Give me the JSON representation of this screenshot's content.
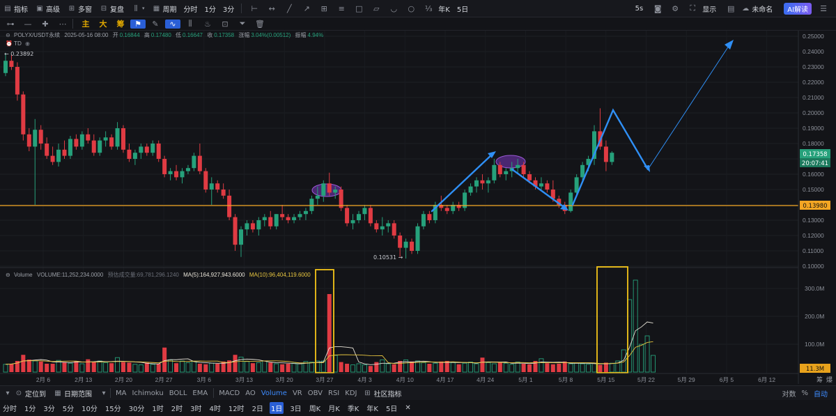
{
  "toolbar": {
    "items": [
      {
        "icon": "indicator-icon",
        "label": "指标"
      },
      {
        "icon": "advanced-icon",
        "label": "高级"
      },
      {
        "icon": "multi-window-icon",
        "label": "多窗"
      },
      {
        "icon": "replay-icon",
        "label": "复盘"
      }
    ],
    "period_label": "周期",
    "quick_periods": [
      "分时",
      "1分",
      "3分"
    ],
    "draw_tools": [
      "horizontal-ray-icon",
      "horizontal-line-icon",
      "trend-line-icon",
      "arrow-line-icon",
      "crosshair-tool-icon",
      "parallel-channel-icon",
      "rectangle-icon",
      "parallelogram-icon",
      "curve-icon",
      "circle-icon",
      "fibonacci-icon"
    ],
    "period_tabs": [
      "年K",
      "5日"
    ],
    "right": {
      "refresh": "5s",
      "display": "显示",
      "unnamed": "未命名",
      "ai": "AI解读"
    }
  },
  "drawbar": {
    "tools": [
      "line-tool-icon",
      "ray-tool-icon",
      "cross-tool-icon",
      "more-icon"
    ],
    "cn_buttons": [
      "主",
      "大",
      "筹"
    ],
    "tail_tools": [
      "marker-icon",
      "ruler-icon",
      "pattern-icon",
      "candle-icon",
      "fire-icon",
      "group-icon",
      "filter-icon",
      "trash-icon"
    ]
  },
  "header": {
    "symbol": "POLYX/USDT永续",
    "datetime": "2025-05-16 08:00",
    "open_label": "开",
    "open": "0.16844",
    "high_label": "高",
    "high": "0.17480",
    "low_label": "低",
    "low": "0.16647",
    "close_label": "收",
    "close": "0.17358",
    "change_label": "涨幅",
    "change": "3.04%(0.00512)",
    "amp_label": "振幅",
    "amp": "4.94%",
    "td": "TD"
  },
  "volume_header": {
    "name": "Volume",
    "volume": "VOLUME:11,252,234.0000",
    "est": "预估成交量:69,781,296.1240",
    "ma5": "MA(5):164,927,943.6000",
    "ma10": "MA(10):96,404,119.6000"
  },
  "chart_data": {
    "type": "candlestick",
    "price_axis": {
      "min": 0.1,
      "max": 0.25,
      "ticks": [
        "0.25000",
        "0.24000",
        "0.23000",
        "0.22000",
        "0.21000",
        "0.20000",
        "0.19000",
        "0.18000",
        "0.17000",
        "0.16000",
        "0.15000",
        "0.14000",
        "0.13000",
        "0.12000",
        "0.11000",
        "0.10000"
      ]
    },
    "volume_axis": {
      "min": 0,
      "max": 350000000,
      "ticks": [
        "300.0M",
        "200.0M",
        "100.0M"
      ]
    },
    "x_labels": [
      "2月 6",
      "2月 13",
      "2月 20",
      "2月 27",
      "3月 6",
      "3月 13",
      "3月 20",
      "3月 27",
      "4月 3",
      "4月 10",
      "4月 17",
      "4月 24",
      "5月 1",
      "5月 8",
      "5月 15",
      "5月 22",
      "5月 29",
      "6月 5",
      "6月 12"
    ],
    "price_tags": {
      "last": "0.17358",
      "countdown": "20:07:41",
      "hline": "0.13980",
      "volume_last": "11.3M"
    },
    "hline_price": 0.1398,
    "annotations": {
      "high_label": "0.23892",
      "low_label": "0.10531"
    },
    "colors": {
      "up": "#26a17b",
      "down": "#e03b43",
      "hline": "#f5a623",
      "arrow": "#2f8ff5",
      "highlight": "#f5c518",
      "ellipse": "#7a3fb3",
      "ma5": "#e8e4d8",
      "ma10": "#e8c640"
    },
    "candles": [
      {
        "o": 0.226,
        "h": 0.239,
        "l": 0.224,
        "c": 0.234
      },
      {
        "o": 0.234,
        "h": 0.238,
        "l": 0.228,
        "c": 0.23
      },
      {
        "o": 0.23,
        "h": 0.233,
        "l": 0.208,
        "c": 0.212
      },
      {
        "o": 0.212,
        "h": 0.214,
        "l": 0.182,
        "c": 0.186
      },
      {
        "o": 0.186,
        "h": 0.19,
        "l": 0.175,
        "c": 0.178
      },
      {
        "o": 0.178,
        "h": 0.196,
        "l": 0.14,
        "c": 0.189
      },
      {
        "o": 0.189,
        "h": 0.192,
        "l": 0.176,
        "c": 0.18
      },
      {
        "o": 0.18,
        "h": 0.184,
        "l": 0.17,
        "c": 0.172
      },
      {
        "o": 0.172,
        "h": 0.178,
        "l": 0.166,
        "c": 0.168
      },
      {
        "o": 0.168,
        "h": 0.18,
        "l": 0.165,
        "c": 0.176
      },
      {
        "o": 0.176,
        "h": 0.182,
        "l": 0.17,
        "c": 0.172
      },
      {
        "o": 0.172,
        "h": 0.185,
        "l": 0.17,
        "c": 0.183
      },
      {
        "o": 0.183,
        "h": 0.186,
        "l": 0.176,
        "c": 0.178
      },
      {
        "o": 0.178,
        "h": 0.188,
        "l": 0.176,
        "c": 0.186
      },
      {
        "o": 0.186,
        "h": 0.19,
        "l": 0.18,
        "c": 0.182
      },
      {
        "o": 0.182,
        "h": 0.186,
        "l": 0.172,
        "c": 0.174
      },
      {
        "o": 0.174,
        "h": 0.184,
        "l": 0.172,
        "c": 0.182
      },
      {
        "o": 0.182,
        "h": 0.188,
        "l": 0.178,
        "c": 0.184
      },
      {
        "o": 0.184,
        "h": 0.186,
        "l": 0.176,
        "c": 0.178
      },
      {
        "o": 0.178,
        "h": 0.194,
        "l": 0.176,
        "c": 0.19
      },
      {
        "o": 0.19,
        "h": 0.192,
        "l": 0.174,
        "c": 0.176
      },
      {
        "o": 0.176,
        "h": 0.18,
        "l": 0.168,
        "c": 0.17
      },
      {
        "o": 0.17,
        "h": 0.176,
        "l": 0.166,
        "c": 0.174
      },
      {
        "o": 0.174,
        "h": 0.18,
        "l": 0.17,
        "c": 0.178
      },
      {
        "o": 0.178,
        "h": 0.18,
        "l": 0.172,
        "c": 0.174
      },
      {
        "o": 0.174,
        "h": 0.182,
        "l": 0.172,
        "c": 0.18
      },
      {
        "o": 0.18,
        "h": 0.182,
        "l": 0.168,
        "c": 0.17
      },
      {
        "o": 0.17,
        "h": 0.172,
        "l": 0.158,
        "c": 0.16
      },
      {
        "o": 0.16,
        "h": 0.164,
        "l": 0.156,
        "c": 0.162
      },
      {
        "o": 0.162,
        "h": 0.166,
        "l": 0.156,
        "c": 0.158
      },
      {
        "o": 0.158,
        "h": 0.164,
        "l": 0.154,
        "c": 0.162
      },
      {
        "o": 0.162,
        "h": 0.166,
        "l": 0.16,
        "c": 0.164
      },
      {
        "o": 0.164,
        "h": 0.174,
        "l": 0.162,
        "c": 0.172
      },
      {
        "o": 0.172,
        "h": 0.18,
        "l": 0.16,
        "c": 0.162
      },
      {
        "o": 0.162,
        "h": 0.164,
        "l": 0.148,
        "c": 0.15
      },
      {
        "o": 0.15,
        "h": 0.158,
        "l": 0.14,
        "c": 0.154
      },
      {
        "o": 0.154,
        "h": 0.156,
        "l": 0.148,
        "c": 0.15
      },
      {
        "o": 0.15,
        "h": 0.154,
        "l": 0.144,
        "c": 0.146
      },
      {
        "o": 0.146,
        "h": 0.15,
        "l": 0.13,
        "c": 0.132
      },
      {
        "o": 0.132,
        "h": 0.134,
        "l": 0.11,
        "c": 0.114
      },
      {
        "o": 0.114,
        "h": 0.126,
        "l": 0.106,
        "c": 0.124
      },
      {
        "o": 0.124,
        "h": 0.13,
        "l": 0.12,
        "c": 0.128
      },
      {
        "o": 0.128,
        "h": 0.13,
        "l": 0.122,
        "c": 0.124
      },
      {
        "o": 0.124,
        "h": 0.132,
        "l": 0.12,
        "c": 0.13
      },
      {
        "o": 0.13,
        "h": 0.134,
        "l": 0.126,
        "c": 0.132
      },
      {
        "o": 0.132,
        "h": 0.136,
        "l": 0.124,
        "c": 0.126
      },
      {
        "o": 0.126,
        "h": 0.134,
        "l": 0.124,
        "c": 0.134
      },
      {
        "o": 0.134,
        "h": 0.14,
        "l": 0.13,
        "c": 0.132
      },
      {
        "o": 0.132,
        "h": 0.134,
        "l": 0.128,
        "c": 0.13
      },
      {
        "o": 0.13,
        "h": 0.134,
        "l": 0.128,
        "c": 0.132
      },
      {
        "o": 0.132,
        "h": 0.136,
        "l": 0.13,
        "c": 0.134
      },
      {
        "o": 0.134,
        "h": 0.138,
        "l": 0.13,
        "c": 0.136
      },
      {
        "o": 0.136,
        "h": 0.146,
        "l": 0.134,
        "c": 0.144
      },
      {
        "o": 0.144,
        "h": 0.152,
        "l": 0.14,
        "c": 0.146
      },
      {
        "o": 0.146,
        "h": 0.156,
        "l": 0.142,
        "c": 0.154
      },
      {
        "o": 0.154,
        "h": 0.161,
        "l": 0.146,
        "c": 0.148
      },
      {
        "o": 0.148,
        "h": 0.152,
        "l": 0.144,
        "c": 0.15
      },
      {
        "o": 0.15,
        "h": 0.152,
        "l": 0.136,
        "c": 0.138
      },
      {
        "o": 0.138,
        "h": 0.14,
        "l": 0.126,
        "c": 0.128
      },
      {
        "o": 0.128,
        "h": 0.134,
        "l": 0.124,
        "c": 0.13
      },
      {
        "o": 0.13,
        "h": 0.136,
        "l": 0.128,
        "c": 0.134
      },
      {
        "o": 0.134,
        "h": 0.14,
        "l": 0.13,
        "c": 0.138
      },
      {
        "o": 0.138,
        "h": 0.14,
        "l": 0.126,
        "c": 0.128
      },
      {
        "o": 0.128,
        "h": 0.13,
        "l": 0.122,
        "c": 0.124
      },
      {
        "o": 0.124,
        "h": 0.132,
        "l": 0.12,
        "c": 0.126
      },
      {
        "o": 0.126,
        "h": 0.13,
        "l": 0.122,
        "c": 0.128
      },
      {
        "o": 0.128,
        "h": 0.13,
        "l": 0.118,
        "c": 0.12
      },
      {
        "o": 0.12,
        "h": 0.122,
        "l": 0.106,
        "c": 0.112
      },
      {
        "o": 0.112,
        "h": 0.118,
        "l": 0.105,
        "c": 0.116
      },
      {
        "o": 0.116,
        "h": 0.118,
        "l": 0.108,
        "c": 0.11
      },
      {
        "o": 0.11,
        "h": 0.128,
        "l": 0.108,
        "c": 0.126
      },
      {
        "o": 0.126,
        "h": 0.136,
        "l": 0.124,
        "c": 0.134
      },
      {
        "o": 0.134,
        "h": 0.136,
        "l": 0.128,
        "c": 0.13
      },
      {
        "o": 0.13,
        "h": 0.142,
        "l": 0.128,
        "c": 0.14
      },
      {
        "o": 0.14,
        "h": 0.146,
        "l": 0.136,
        "c": 0.138
      },
      {
        "o": 0.138,
        "h": 0.14,
        "l": 0.134,
        "c": 0.136
      },
      {
        "o": 0.136,
        "h": 0.142,
        "l": 0.134,
        "c": 0.14
      },
      {
        "o": 0.14,
        "h": 0.142,
        "l": 0.136,
        "c": 0.138
      },
      {
        "o": 0.138,
        "h": 0.15,
        "l": 0.136,
        "c": 0.148
      },
      {
        "o": 0.148,
        "h": 0.154,
        "l": 0.146,
        "c": 0.152
      },
      {
        "o": 0.152,
        "h": 0.158,
        "l": 0.148,
        "c": 0.156
      },
      {
        "o": 0.156,
        "h": 0.16,
        "l": 0.15,
        "c": 0.154
      },
      {
        "o": 0.154,
        "h": 0.158,
        "l": 0.148,
        "c": 0.156
      },
      {
        "o": 0.156,
        "h": 0.17,
        "l": 0.154,
        "c": 0.166
      },
      {
        "o": 0.166,
        "h": 0.168,
        "l": 0.158,
        "c": 0.16
      },
      {
        "o": 0.16,
        "h": 0.164,
        "l": 0.156,
        "c": 0.162
      },
      {
        "o": 0.162,
        "h": 0.168,
        "l": 0.158,
        "c": 0.164
      },
      {
        "o": 0.164,
        "h": 0.17,
        "l": 0.16,
        "c": 0.166
      },
      {
        "o": 0.166,
        "h": 0.168,
        "l": 0.158,
        "c": 0.16
      },
      {
        "o": 0.16,
        "h": 0.162,
        "l": 0.154,
        "c": 0.156
      },
      {
        "o": 0.156,
        "h": 0.158,
        "l": 0.15,
        "c": 0.152
      },
      {
        "o": 0.152,
        "h": 0.158,
        "l": 0.15,
        "c": 0.154
      },
      {
        "o": 0.154,
        "h": 0.156,
        "l": 0.148,
        "c": 0.15
      },
      {
        "o": 0.15,
        "h": 0.156,
        "l": 0.142,
        "c": 0.144
      },
      {
        "o": 0.144,
        "h": 0.146,
        "l": 0.138,
        "c": 0.14
      },
      {
        "o": 0.14,
        "h": 0.142,
        "l": 0.134,
        "c": 0.136
      },
      {
        "o": 0.136,
        "h": 0.15,
        "l": 0.135,
        "c": 0.148
      },
      {
        "o": 0.148,
        "h": 0.16,
        "l": 0.146,
        "c": 0.158
      },
      {
        "o": 0.158,
        "h": 0.168,
        "l": 0.156,
        "c": 0.166
      },
      {
        "o": 0.166,
        "h": 0.172,
        "l": 0.162,
        "c": 0.17
      },
      {
        "o": 0.17,
        "h": 0.192,
        "l": 0.166,
        "c": 0.188
      },
      {
        "o": 0.188,
        "h": 0.203,
        "l": 0.176,
        "c": 0.178
      },
      {
        "o": 0.178,
        "h": 0.182,
        "l": 0.162,
        "c": 0.168
      },
      {
        "o": 0.168,
        "h": 0.175,
        "l": 0.166,
        "c": 0.174
      }
    ],
    "volumes": [
      28,
      30,
      40,
      62,
      45,
      40,
      38,
      30,
      30,
      42,
      36,
      32,
      40,
      30,
      46,
      38,
      40,
      34,
      32,
      52,
      36,
      34,
      28,
      26,
      34,
      28,
      30,
      88,
      44,
      32,
      40,
      34,
      38,
      30,
      28,
      32,
      30,
      38,
      42,
      62,
      54,
      38,
      32,
      34,
      40,
      34,
      30,
      28,
      30,
      32,
      30,
      38,
      36,
      40,
      40,
      280,
      60,
      36,
      30,
      26,
      30,
      26,
      22,
      36,
      44,
      30,
      28,
      40,
      44,
      38,
      40,
      34,
      30,
      32,
      38,
      40,
      34,
      28,
      32,
      36,
      30,
      52,
      34,
      30,
      34,
      32,
      28,
      36,
      30,
      28,
      40,
      48,
      32,
      28,
      30,
      38,
      30,
      32,
      30,
      28,
      32,
      26,
      34,
      32,
      40,
      80,
      260,
      330,
      100,
      130,
      60
    ]
  },
  "bottom": {
    "locate": "定位到",
    "range": "日期范围",
    "indicators": [
      "MA",
      "Ichimoku",
      "BOLL",
      "EMA",
      "MACD",
      "AO",
      "Volume",
      "VR",
      "OBV",
      "RSI",
      "KDJ"
    ],
    "active_indicator": "Volume",
    "community": "社区指标",
    "right": [
      "对数",
      "%",
      "自动"
    ]
  },
  "timeframes": [
    "分时",
    "1分",
    "3分",
    "5分",
    "10分",
    "15分",
    "30分",
    "1时",
    "2时",
    "3时",
    "4时",
    "12时",
    "2日",
    "1日",
    "3日",
    "周K",
    "月K",
    "季K",
    "年K",
    "5日"
  ],
  "active_timeframe": "1日"
}
